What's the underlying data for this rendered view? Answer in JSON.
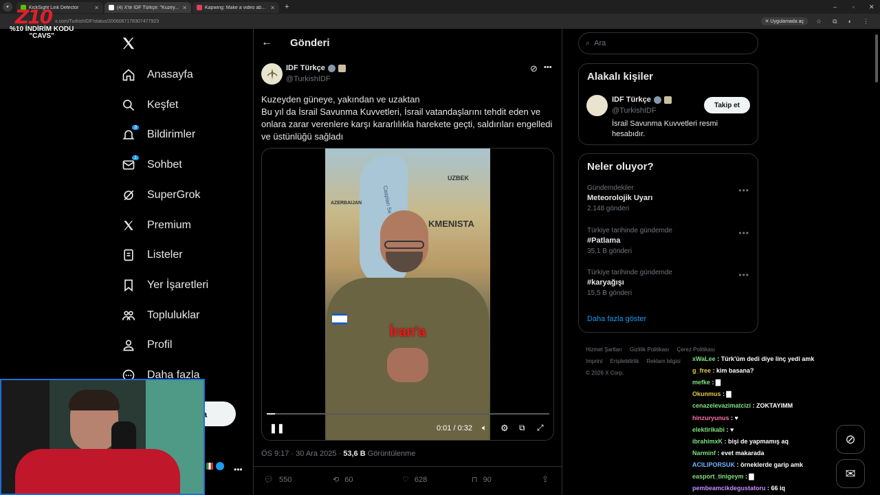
{
  "browser": {
    "tabs": [
      {
        "label": "KickSight Link Detector",
        "color": "#53c400",
        "active": false
      },
      {
        "label": "(4) X'te IDF Türkçe: \"Kuzey...",
        "color": "#ffffff",
        "active": true
      },
      {
        "label": "Kapwing: Make a video about ...",
        "color": "#e03e5c",
        "active": false
      }
    ],
    "url": "x.com/TurkishIDF/status/2006067178307477923",
    "app_chip": "Uygulamada aç"
  },
  "overlay": {
    "logo": "Z10",
    "promo_line1": "%10 İNDİRİM KODU",
    "promo_line2": "\"CAVS\""
  },
  "nav": {
    "items": [
      {
        "label": "Anasayfa",
        "icon": "home-icon",
        "badge": ""
      },
      {
        "label": "Keşfet",
        "icon": "search-icon",
        "badge": ""
      },
      {
        "label": "Bildirimler",
        "icon": "bell-icon",
        "badge": "3"
      },
      {
        "label": "Sohbet",
        "icon": "mail-icon",
        "badge": "1"
      },
      {
        "label": "SuperGrok",
        "icon": "grok-icon",
        "badge": ""
      },
      {
        "label": "Premium",
        "icon": "x-icon",
        "badge": ""
      },
      {
        "label": "Listeler",
        "icon": "list-icon",
        "badge": ""
      },
      {
        "label": "Yer İşaretleri",
        "icon": "bookmark-icon",
        "badge": ""
      },
      {
        "label": "Topluluklar",
        "icon": "people-icon",
        "badge": ""
      },
      {
        "label": "Profil",
        "icon": "person-icon",
        "badge": ""
      },
      {
        "label": "Daha fazla",
        "icon": "more-circle-icon",
        "badge": ""
      }
    ],
    "post_button_partial": "a"
  },
  "post": {
    "header_title": "Gönderi",
    "author_name": "IDF Türkçe",
    "author_handle": "@TurkishIDF",
    "text_line1": "Kuzeyden güneye, yakından ve uzaktan",
    "text_body": "Bu yıl da İsrail Savunma Kuvvetleri, İsrail vatandaşlarını tehdit eden ve onlara zarar verenlere karşı kararlılıkla harekete geçti, saldırıları engelledi ve üstünlüğü sağladı",
    "video_caption": "İran'a",
    "map_labels": [
      "UZBEK",
      "AZERBAIJAN",
      "KMENISTA",
      "Caspian Se"
    ],
    "video_time": "0:01 / 0:32",
    "video_progress": 0.03,
    "timestamp": "ÖS 9:17 · 30 Ara 2025 · ",
    "views_count": "53,6 B",
    "views_label": " Görüntülenme",
    "stats": {
      "replies": "550",
      "reposts": "60",
      "likes": "628",
      "bookmarks": "90"
    }
  },
  "right": {
    "search_placeholder": "Ara",
    "related_title": "Alakalı kişiler",
    "related_name": "IDF Türkçe",
    "related_handle": "@TurkishIDF",
    "related_bio": "İsrail Savunma Kuvvetleri resmi hesabıdır.",
    "follow_label": "Takip et",
    "trends_title": "Neler oluyor?",
    "trends": [
      {
        "context": "Gündemdekiler",
        "title": "Meteorolojik Uyarı",
        "count": "2.148 gönderi"
      },
      {
        "context": "Türkiye tarihinde gündemde",
        "title": "#Patlama",
        "count": "35,1 B gönderi"
      },
      {
        "context": "Türkiye tarihinde gündemde",
        "title": "#karyağışı",
        "count": "15,5 B gönderi"
      }
    ],
    "show_more": "Daha fazla göster",
    "footer_row1": [
      "Hizmet Şartları",
      "Gizlilik Politikası",
      "Çerez Politikası"
    ],
    "footer_row2": [
      "Imprint",
      "Erişilebilirlik",
      "Reklam bilgisi"
    ],
    "copyright": "© 2026 X Corp."
  },
  "chat": [
    {
      "user": "xWaLee",
      "color": "#7fe07f",
      "msg": "Türk'üm dedi diye linç yedi amk"
    },
    {
      "user": "g_free",
      "color": "#e6c84a",
      "msg": "kim basana?"
    },
    {
      "user": "mefke",
      "color": "#7fe07f",
      "msg": "▇"
    },
    {
      "user": "Okunmus",
      "color": "#e6c84a",
      "msg": "▇"
    },
    {
      "user": "cenazelevazimatcizi",
      "color": "#7fe07f",
      "msg": "ZOKTAYIMM"
    },
    {
      "user": "hinzuryunus",
      "color": "#ff6fa8",
      "msg": "♥"
    },
    {
      "user": "elektirikabi",
      "color": "#7fe07f",
      "msg": "♥"
    },
    {
      "user": "ibrahimxK",
      "color": "#7fe07f",
      "msg": "bişi de yapmamış aq"
    },
    {
      "user": "Narminf",
      "color": "#7fe07f",
      "msg": "evet makarada"
    },
    {
      "user": "ACILIPORSUK",
      "color": "#6fb6ff",
      "msg": "örneklerde garip amk"
    },
    {
      "user": "easport_tinigeym",
      "color": "#7fe07f",
      "msg": "▇"
    },
    {
      "user": "pembeamcikdegustatoru",
      "color": "#c58cff",
      "msg": "66 iq"
    }
  ]
}
